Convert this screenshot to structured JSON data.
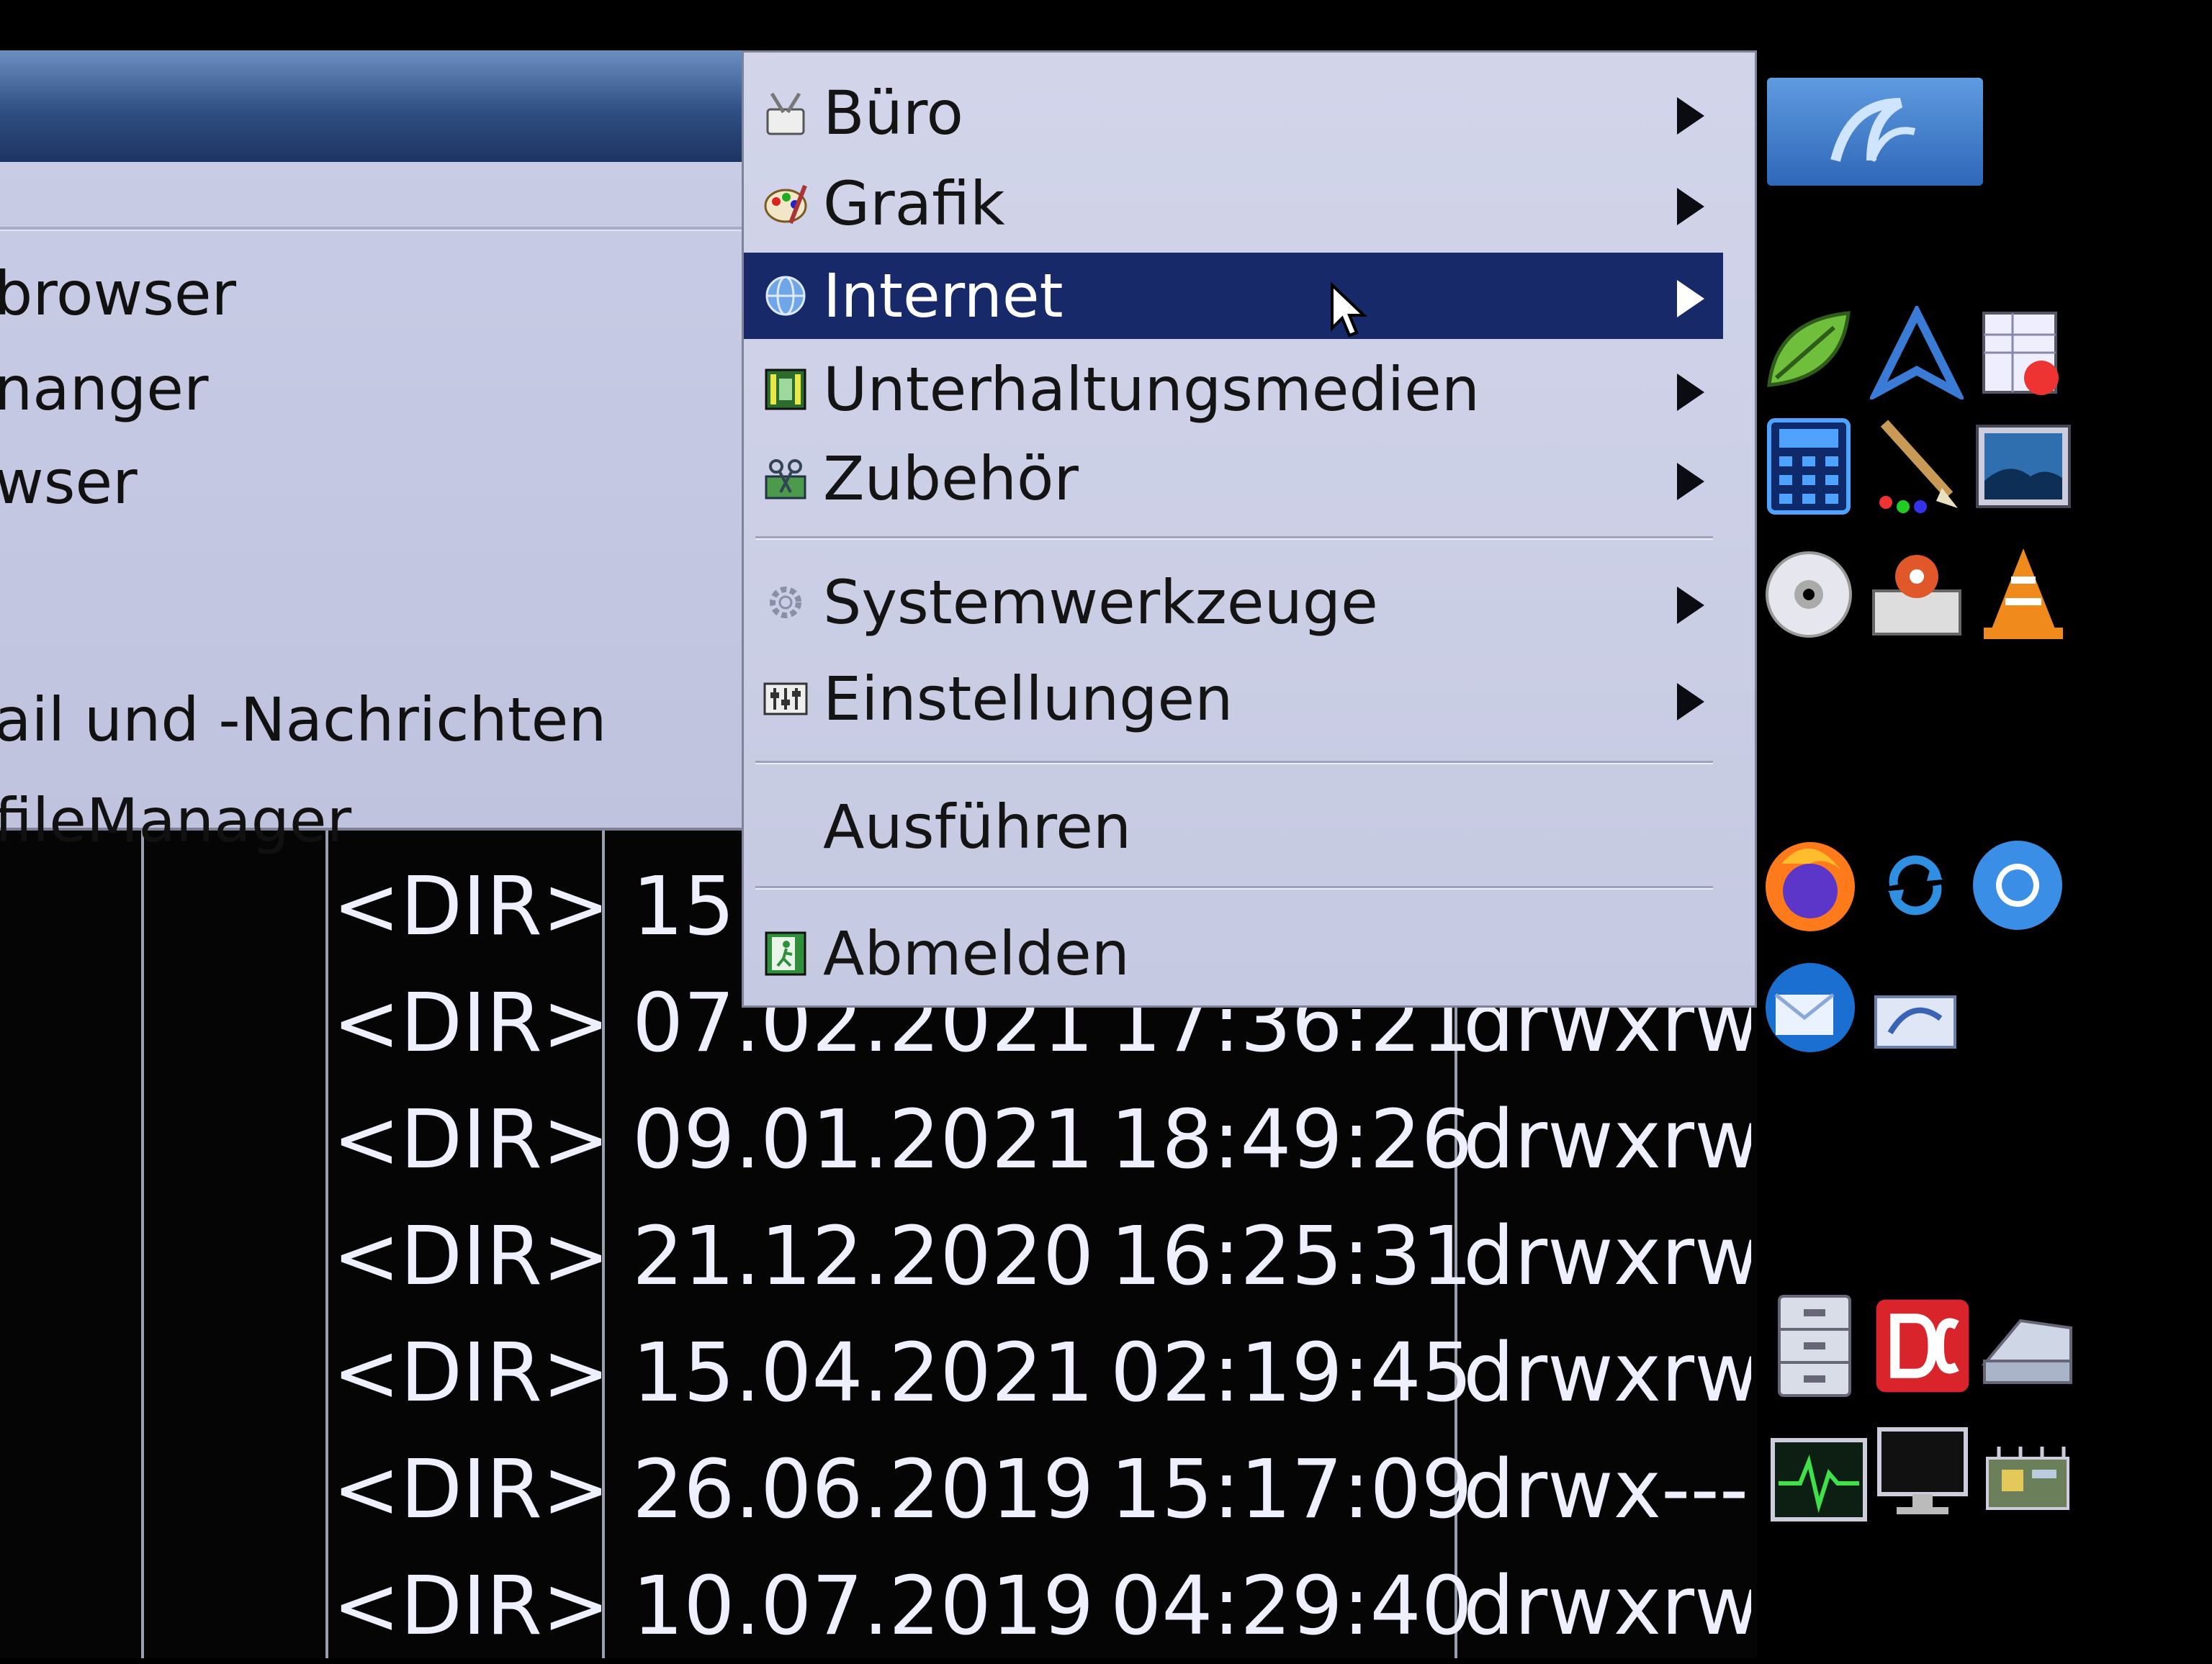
{
  "submenu": {
    "items": [
      {
        "label": "browser"
      },
      {
        "label": "nanger"
      },
      {
        "label": "wser"
      },
      {
        "label": "ail und -Nachrichten"
      },
      {
        "label": "fileManager"
      }
    ]
  },
  "main_menu": {
    "items": [
      {
        "label": "Büro",
        "icon": "office-icon",
        "submenu": true
      },
      {
        "label": "Grafik",
        "icon": "graphics-icon",
        "submenu": true
      },
      {
        "label": "Internet",
        "icon": "globe-icon",
        "submenu": true,
        "selected": true
      },
      {
        "label": "Unterhaltungsmedien",
        "icon": "multimedia-icon",
        "submenu": true
      },
      {
        "label": "Zubehör",
        "icon": "accessories-icon",
        "submenu": true
      },
      {
        "label": "Systemwerkzeuge",
        "icon": "gear-icon",
        "submenu": true
      },
      {
        "label": "Einstellungen",
        "icon": "settings-icon",
        "submenu": true
      },
      {
        "label": "Ausführen",
        "icon": "",
        "submenu": false
      },
      {
        "label": "Abmelden",
        "icon": "logout-icon",
        "submenu": false
      }
    ]
  },
  "file_list": {
    "rows": [
      {
        "type": "<DIR>",
        "date": "15",
        "time": "",
        "perms": ""
      },
      {
        "type": "<DIR>",
        "date": "07.02.2021",
        "time": "17:36:21",
        "perms": "drwxrw"
      },
      {
        "type": "<DIR>",
        "date": "09.01.2021",
        "time": "18:49:26",
        "perms": "drwxrw"
      },
      {
        "type": "<DIR>",
        "date": "21.12.2020",
        "time": "16:25:31",
        "perms": "drwxrw"
      },
      {
        "type": "<DIR>",
        "date": "15.04.2021",
        "time": "02:19:45",
        "perms": "drwxrw"
      },
      {
        "type": "<DIR>",
        "date": "26.06.2019",
        "time": "15:17:09",
        "perms": "drwx---"
      },
      {
        "type": "<DIR>",
        "date": "10.07.2019",
        "time": "04:29:40",
        "perms": "drwxrw"
      }
    ]
  },
  "colors": {
    "menu_bg": "#c9cde6",
    "menu_selected": "#18296a",
    "list_bg": "#050505",
    "list_text": "#eef0ff"
  }
}
